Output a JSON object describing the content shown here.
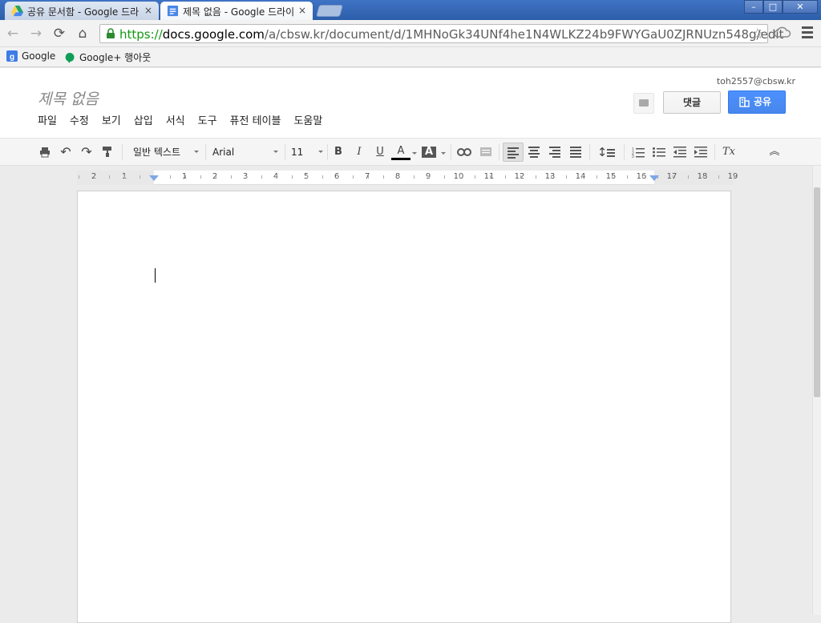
{
  "browser": {
    "tabs": [
      {
        "title": "공유 문서함 - Google 드라",
        "close": "×"
      },
      {
        "title": "제목 없음 - Google 드라이",
        "close": "×"
      }
    ],
    "window_buttons": {
      "minimize": "–",
      "maximize": "□",
      "close": "✕"
    },
    "url_scheme": "https://",
    "url_host": "docs.google.com",
    "url_path": "/a/cbsw.kr/document/d/1MHNoGk34UNf4he1N4WLKZ24b9FWYGaU0ZJRNUzn548g/edit",
    "bookmarks": [
      {
        "label": "Google",
        "icon": "google-icon"
      },
      {
        "label": "Google+ 행아웃",
        "icon": "hangouts-icon"
      }
    ]
  },
  "docs": {
    "title": "제목 없음",
    "account": "toh2557@cbsw.kr",
    "menu": [
      "파일",
      "수정",
      "보기",
      "삽입",
      "서식",
      "도구",
      "퓨전 테이블",
      "도움말"
    ],
    "comments_label": "댓글",
    "share_label": "공유"
  },
  "toolbar": {
    "style": "일반 텍스트",
    "font": "Arial",
    "size": "11",
    "bold": "B",
    "italic": "I",
    "underline": "U",
    "text_color": "A",
    "highlight": "A",
    "clear_format": "Tx"
  },
  "ruler": {
    "labels": [
      "2",
      "1",
      "1",
      "2",
      "3",
      "4",
      "5",
      "6",
      "7",
      "8",
      "9",
      "10",
      "11",
      "12",
      "13",
      "14",
      "15",
      "16",
      "17",
      "18",
      "19"
    ]
  }
}
